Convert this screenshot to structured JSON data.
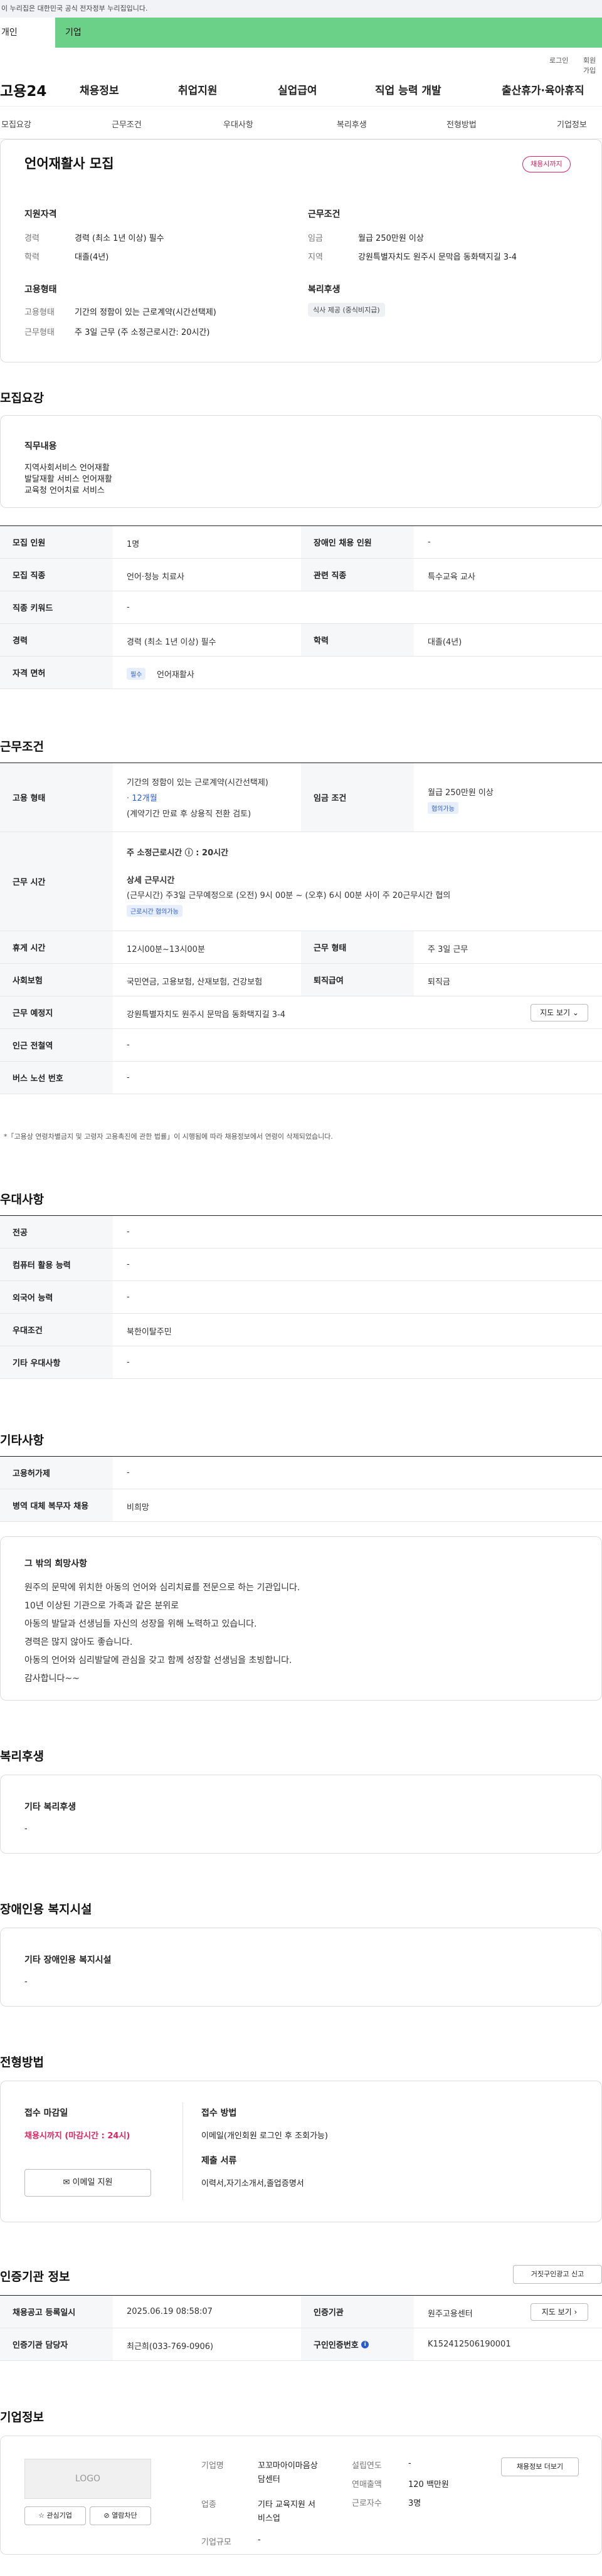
{
  "gov_banner": "이 누리집은 대한민국 공식 전자정부 누리집입니다.",
  "user_tabs": {
    "individual": "개인",
    "company": "기업"
  },
  "util": {
    "login": "로그인",
    "join": "회원가입"
  },
  "gnb": {
    "logo": "고용24",
    "menu": [
      "채용정보",
      "취업지원",
      "실업급여",
      "직업 능력 개발",
      "출산휴가·육아휴직"
    ]
  },
  "anchor_nav": [
    "모집요강",
    "근무조건",
    "우대사항",
    "복리후생",
    "전형방법",
    "기업정보"
  ],
  "summary": {
    "title": "언어재활사 모집",
    "badge": "채용시까지",
    "qual": {
      "label": "지원자격",
      "career_k": "경력",
      "career_v": "경력 (최소 1년 이상) 필수",
      "edu_k": "학력",
      "edu_v": "대졸(4년)"
    },
    "cond": {
      "label": "근무조건",
      "wage_k": "임금",
      "wage_v": "월급 250만원 이상",
      "region_k": "지역",
      "region_v": "강원특별자치도 원주시 문막읍 동화택지길 3-4"
    },
    "emp": {
      "label": "고용형태",
      "type_k": "고용형태",
      "type_v": "기간의 정함이 있는 근로계약(시간선택제)",
      "work_k": "근무형태",
      "work_v": "주 3일 근무 (주 소정근로시간: 20시간)"
    },
    "welfare": {
      "label": "복리후생",
      "chip": "식사 제공 (중식비지급)"
    }
  },
  "recruit": {
    "title": "모집요강",
    "duty_label": "직무내용",
    "duty_lines": [
      "지역사회서비스 언어재활",
      "발달재활 서비스 언어재활",
      "교육청 언어치료 서비스"
    ],
    "rows": {
      "r1": {
        "k1": "모집 인원",
        "v1": "1명",
        "k2": "장애인 채용 인원",
        "v2": "-"
      },
      "r2": {
        "k1": "모집 직종",
        "v1": "언어·청능 치료사",
        "k2": "관련 직종",
        "v2": "특수교육 교사"
      },
      "r3": {
        "k1": "직종 키워드",
        "v1": "-"
      },
      "r4": {
        "k1": "경력",
        "v1": "경력 (최소 1년 이상) 필수",
        "k2": "학력",
        "v2": "대졸(4년)"
      },
      "r5": {
        "k1": "자격 면허",
        "tag": "필수",
        "v1": "언어재활사"
      }
    }
  },
  "work": {
    "title": "근무조건",
    "emp_k": "고용 형태",
    "emp_v1": "기간의 정함이 있는 근로계약(시간선택제)",
    "emp_period": "· 12개월",
    "emp_v3": "(계약기간 만료 후 상용직 전환 검토)",
    "wage_k": "임금 조건",
    "wage_v": "월급 250만원 이상",
    "wage_tag": "협의가능",
    "time_k": "근무 시간",
    "time_hours": "주 소정근로시간 ⓘ : 20시간",
    "time_detail_label": "상세 근무시간",
    "time_detail": "(근무시간) 주3일 근무예정으로 (오전) 9시 00분 ~ (오후) 6시 00분 사이 주 20근무시간 협의",
    "time_tag": "근로시간 협의가능",
    "rest_k": "휴게 시간",
    "rest_v": "12시00분~13시00분",
    "form_k": "근무 형태",
    "form_v": "주 3일 근무",
    "ins_k": "사회보험",
    "ins_v": "국민연금, 고용보험, 산재보험, 건강보험",
    "ret_k": "퇴직급여",
    "ret_v": "퇴직금",
    "place_k": "근무 예정지",
    "place_v": "강원특별자치도 원주시 문막읍 동화택지길 3-4",
    "map_btn": "지도 보기 ⌄",
    "sub_k": "인근 전철역",
    "sub_v": "-",
    "bus_k": "버스 노선 번호",
    "bus_v": "-",
    "note": "*「고용상 연령차별금지 및 고령자 고용촉진에 관한 법률」이 시행됨에 따라 채용정보에서 연령이 삭제되었습니다."
  },
  "pref": {
    "title": "우대사항",
    "rows": [
      {
        "k": "전공",
        "v": "-"
      },
      {
        "k": "컴퓨터 활용 능력",
        "v": "-"
      },
      {
        "k": "외국어 능력",
        "v": "-"
      },
      {
        "k": "우대조건",
        "v": "북한이탈주민"
      },
      {
        "k": "기타 우대사항",
        "v": "-"
      }
    ]
  },
  "etc": {
    "title": "기타사항",
    "rows": [
      {
        "k": "고용허가제",
        "v": "-"
      },
      {
        "k": "병역 대체 복무자 채용",
        "v": "비희망"
      }
    ],
    "wish_label": "그 밖의 희망사항",
    "wish_lines": [
      "원주의 문막에 위치한  아동의 언어와 심리치료를 전문으로 하는 기관입니다.",
      "10년 이상된 기관으로 가족과 같은 분위로",
      "아동의 발달과 선생님들 자신의 성장을 위해 노력하고 있습니다.",
      "경력은 많지 않아도 좋습니다.",
      "아동의 언어와 심리발달에 관심을 갖고 함께 성장할 선생님을 초빙합니다.",
      "감사합니다~~"
    ]
  },
  "benefit": {
    "title": "복리후생",
    "label": "기타 복리후생",
    "value": "-"
  },
  "disab": {
    "title": "장애인용 복지시설",
    "label": "기타 장애인용 복지시설",
    "value": "-"
  },
  "select": {
    "title": "전형방법",
    "deadline_label": "접수 마감일",
    "deadline": "채용시까지 (마감시간 : 24시)",
    "email_btn": "✉ 이메일 지원",
    "method_label": "접수 방법",
    "method": "이메일(개인회원 로그인 후 조회가능)",
    "docs_label": "제출 서류",
    "docs": "이력서,자기소개서,졸업증명서"
  },
  "cert": {
    "title": "인증기관 정보",
    "report_btn": "거짓구인광고 신고",
    "reg_k": "채용공고 등록일시",
    "reg_v": "2025.06.19 08:58:07",
    "org_k": "인증기관",
    "org_v": "원주고용센터",
    "map_btn": "지도 보기 ›",
    "mgr_k": "인증기관 담당자",
    "mgr_v": "최근희(033-769-0906)",
    "num_k": "구인인증번호",
    "num_v": "K152412506190001"
  },
  "company": {
    "title": "기업정보",
    "logo": "LOGO",
    "fav_btn": "☆ 관심기업",
    "block_btn": "⊘ 열람차단",
    "name_k": "기업명",
    "name_v1": "꼬꼬마아이마음상",
    "name_v2": "담센터",
    "ind_k": "업종",
    "ind_v1": "기타 교육지원 서",
    "ind_v2": "비스업",
    "size_k": "기업규모",
    "size_v": "-",
    "est_k": "설립연도",
    "est_v": "-",
    "sales_k": "연매출액",
    "sales_v": "120 백만원",
    "emp_k": "근로자수",
    "emp_v": "3명",
    "info_btn": "채용정보 더보기"
  }
}
